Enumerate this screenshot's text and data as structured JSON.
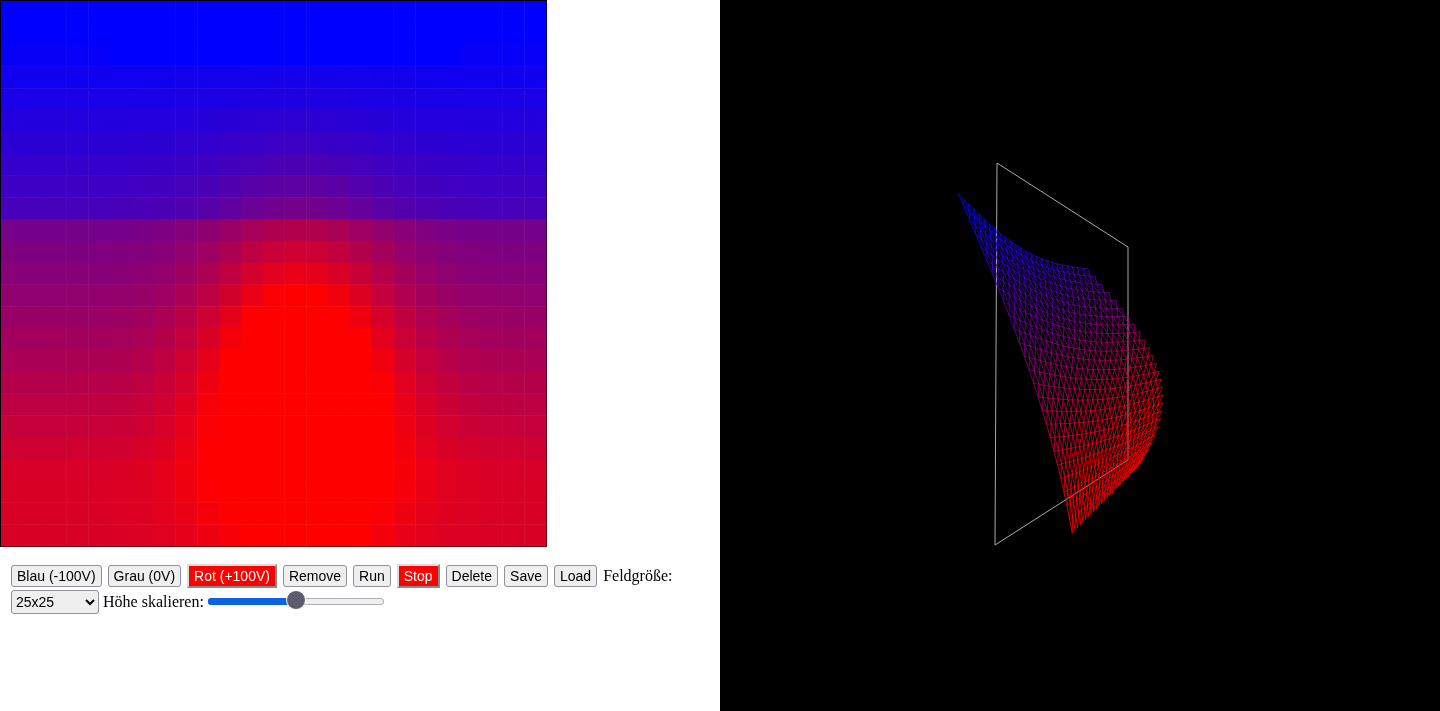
{
  "buttons": [
    {
      "label": "Blau (-100V)",
      "active": false
    },
    {
      "label": "Grau (0V)",
      "active": false
    },
    {
      "label": "Rot (+100V)",
      "active": true
    },
    {
      "label": "Remove",
      "active": false
    },
    {
      "label": "Run",
      "active": false
    },
    {
      "label": "Stop",
      "active": true
    },
    {
      "label": "Delete",
      "active": false
    },
    {
      "label": "Save",
      "active": false
    },
    {
      "label": "Load",
      "active": false
    }
  ],
  "field_size": {
    "label": "Feldgröße:",
    "value": "25x25"
  },
  "height_scale": {
    "label": "Höhe skalieren:",
    "level": 0.5
  }
}
